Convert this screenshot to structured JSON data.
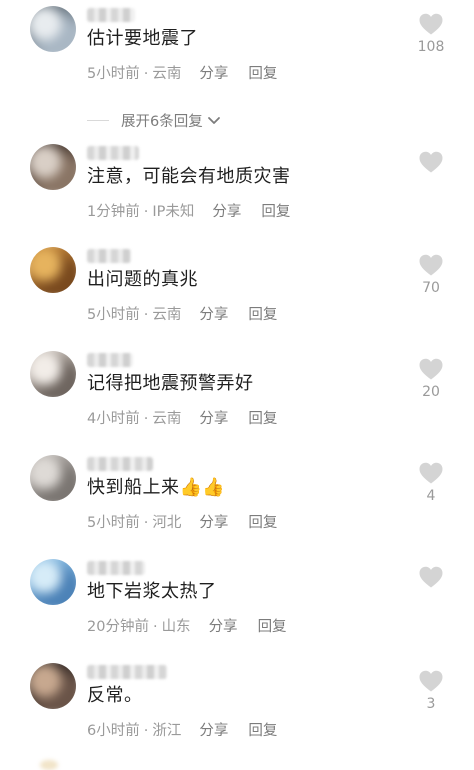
{
  "comments": [
    {
      "text": "估计要地震了",
      "time": "5小时前",
      "location": "云南",
      "share": "分享",
      "reply": "回复",
      "likes": "108",
      "expand": "展开6条回复",
      "avatar_colors": [
        "#5a6670",
        "#a9b7c4",
        "#e8ecef"
      ]
    },
    {
      "text": "注意，可能会有地质灾害",
      "time": "1分钟前",
      "location": "IP未知",
      "share": "分享",
      "reply": "回复",
      "likes": "",
      "avatar_colors": [
        "#3a2e28",
        "#8a7565",
        "#d9cfc6"
      ]
    },
    {
      "text": "出问题的真兆",
      "time": "5小时前",
      "location": "云南",
      "share": "分享",
      "reply": "回复",
      "likes": "70",
      "avatar_colors": [
        "#c98a3a",
        "#7a4a1e",
        "#e6b35e"
      ]
    },
    {
      "text": "记得把地震预警弄好",
      "time": "4小时前",
      "location": "云南",
      "share": "分享",
      "reply": "回复",
      "likes": "20",
      "avatar_colors": [
        "#cfc7c0",
        "#6f6660",
        "#f2ede8"
      ]
    },
    {
      "text": "快到船上来👍👍",
      "time": "5小时前",
      "location": "河北",
      "share": "分享",
      "reply": "回复",
      "likes": "4",
      "avatar_colors": [
        "#b9b4b0",
        "#7b7672",
        "#dedad6"
      ]
    },
    {
      "text": "地下岩浆太热了",
      "time": "20分钟前",
      "location": "山东",
      "share": "分享",
      "reply": "回复",
      "likes": "",
      "avatar_colors": [
        "#8fc3e8",
        "#4d83b8",
        "#d6ecf8"
      ]
    },
    {
      "text": "反常。",
      "time": "6小时前",
      "location": "浙江",
      "share": "分享",
      "reply": "回复",
      "likes": "3",
      "avatar_colors": [
        "#2b2320",
        "#6a5448",
        "#c7a88f"
      ]
    }
  ],
  "colors": {
    "text": "#1f1f1f",
    "meta": "#9a9a9a",
    "action": "#7c7c7c",
    "heart": "#d4d4d4"
  },
  "icons": {
    "like": "heart-icon",
    "expand": "chevron-down-icon"
  }
}
